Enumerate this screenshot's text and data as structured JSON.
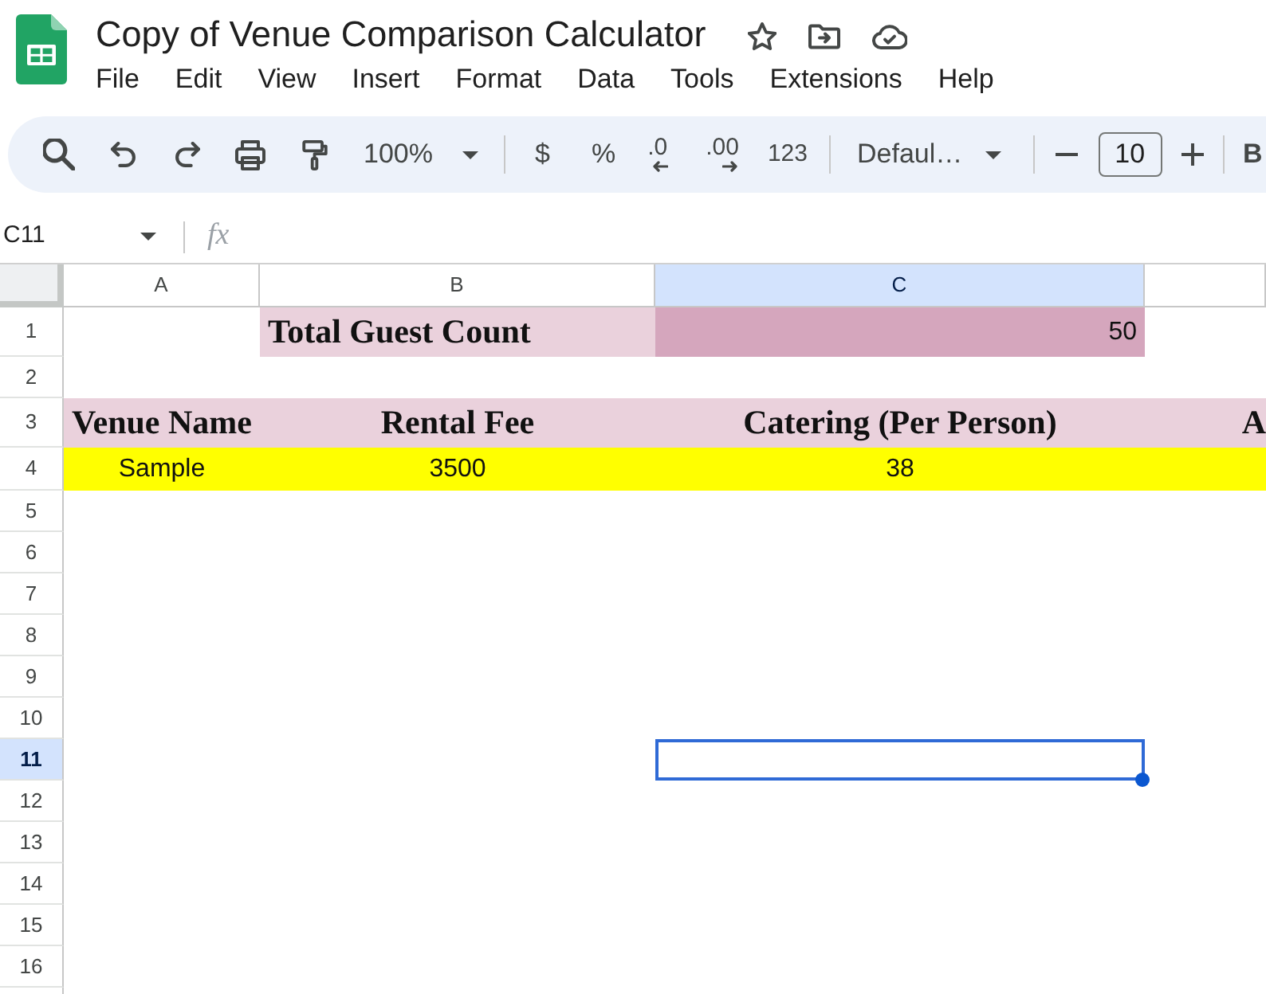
{
  "document": {
    "title": "Copy of Venue Comparison Calculator"
  },
  "menu": [
    "File",
    "Edit",
    "View",
    "Insert",
    "Format",
    "Data",
    "Tools",
    "Extensions",
    "Help"
  ],
  "toolbar": {
    "zoom": "100%",
    "currency": "$",
    "percent": "%",
    "decrease_decimal": ".0",
    "increase_decimal": ".00",
    "number_format": "123",
    "font": "Defaul…",
    "font_size": "10",
    "bold": "B"
  },
  "formula_bar": {
    "cell_reference": "C11",
    "function_label": "fx"
  },
  "grid": {
    "columns": [
      {
        "label": "A",
        "selected": false
      },
      {
        "label": "B",
        "selected": false
      },
      {
        "label": "C",
        "selected": true
      },
      {
        "selected": false
      }
    ],
    "rows": [
      {
        "label": "1",
        "selected": false,
        "cells": [
          {
            "kind": "blank"
          },
          {
            "kind": "label",
            "text": "Total Guest Count",
            "color": "#ead1dc"
          },
          {
            "kind": "number",
            "text": "50",
            "color": "#d5a6bd"
          },
          {
            "kind": "blank"
          }
        ]
      },
      {
        "label": "2",
        "selected": false
      },
      {
        "label": "3",
        "selected": false,
        "cells": [
          {
            "kind": "heading",
            "text": "Venue Name",
            "color": "#ead1dc"
          },
          {
            "kind": "heading",
            "text": "Rental Fee",
            "color": "#ead1dc"
          },
          {
            "kind": "heading",
            "text": "Catering (Per Person)",
            "color": "#ead1dc"
          },
          {
            "kind": "heading",
            "text": "A",
            "color": "#ead1dc"
          }
        ]
      },
      {
        "label": "4",
        "selected": false,
        "cells": [
          {
            "kind": "value",
            "text": "Sample",
            "color": "#ffff00"
          },
          {
            "kind": "value",
            "text": "3500",
            "color": "#ffff00"
          },
          {
            "kind": "value",
            "text": "38",
            "color": "#ffff00"
          },
          {
            "kind": "blank",
            "color": "#ffff00"
          }
        ]
      },
      {
        "label": "5",
        "selected": false
      },
      {
        "label": "6",
        "selected": false
      },
      {
        "label": "7",
        "selected": false
      },
      {
        "label": "8",
        "selected": false
      },
      {
        "label": "9",
        "selected": false
      },
      {
        "label": "10",
        "selected": false
      },
      {
        "label": "11",
        "selected": true
      },
      {
        "label": "12",
        "selected": false
      },
      {
        "label": "13",
        "selected": false
      },
      {
        "label": "14",
        "selected": false
      },
      {
        "label": "15",
        "selected": false
      },
      {
        "label": "16",
        "selected": false
      }
    ]
  }
}
